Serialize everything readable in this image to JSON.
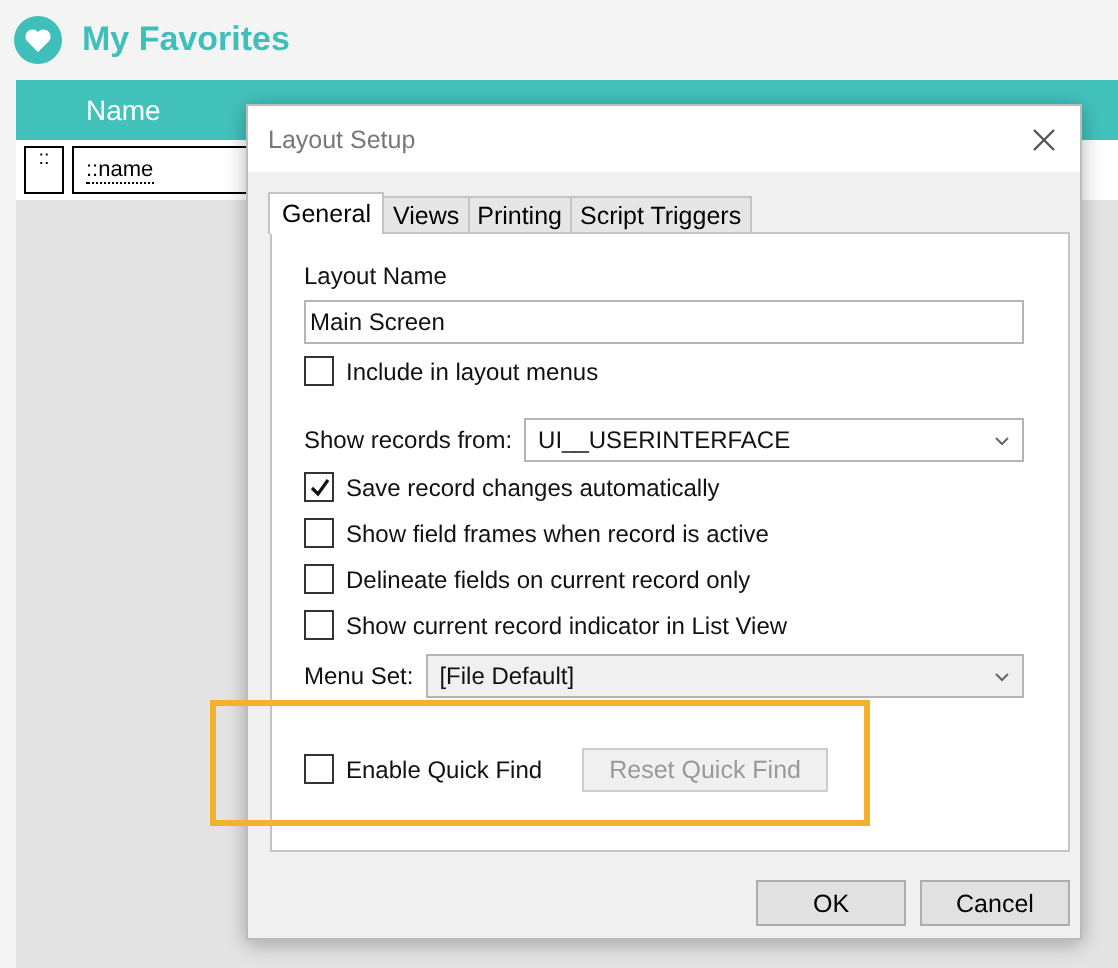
{
  "app": {
    "title": "My Favorites"
  },
  "table": {
    "columns": [
      "Name"
    ],
    "row": {
      "handle": "::",
      "name_field": "::name"
    }
  },
  "dialog": {
    "title": "Layout Setup",
    "tabs": [
      {
        "label": "General",
        "selected": true
      },
      {
        "label": "Views",
        "selected": false
      },
      {
        "label": "Printing",
        "selected": false
      },
      {
        "label": "Script Triggers",
        "selected": false
      }
    ],
    "layout_name_label": "Layout Name",
    "layout_name": "Main Screen",
    "include_option": {
      "label": "Include in layout menus",
      "checked": false
    },
    "show_records_label": "Show records from:",
    "show_records_value": "UI__USERINTERFACE",
    "record_options": [
      {
        "label": "Save record changes automatically",
        "checked": true
      },
      {
        "label": "Show field frames when record is active",
        "checked": false
      },
      {
        "label": "Delineate fields on current record only",
        "checked": false
      },
      {
        "label": "Show current record indicator in List View",
        "checked": false
      }
    ],
    "menu_set_label": "Menu Set:",
    "menu_set_value": "[File Default]",
    "quick_find": {
      "label": "Enable Quick Find",
      "checked": false
    },
    "reset_button": {
      "label": "Reset Quick Find",
      "disabled": true
    },
    "buttons": [
      "OK",
      "Cancel"
    ]
  }
}
